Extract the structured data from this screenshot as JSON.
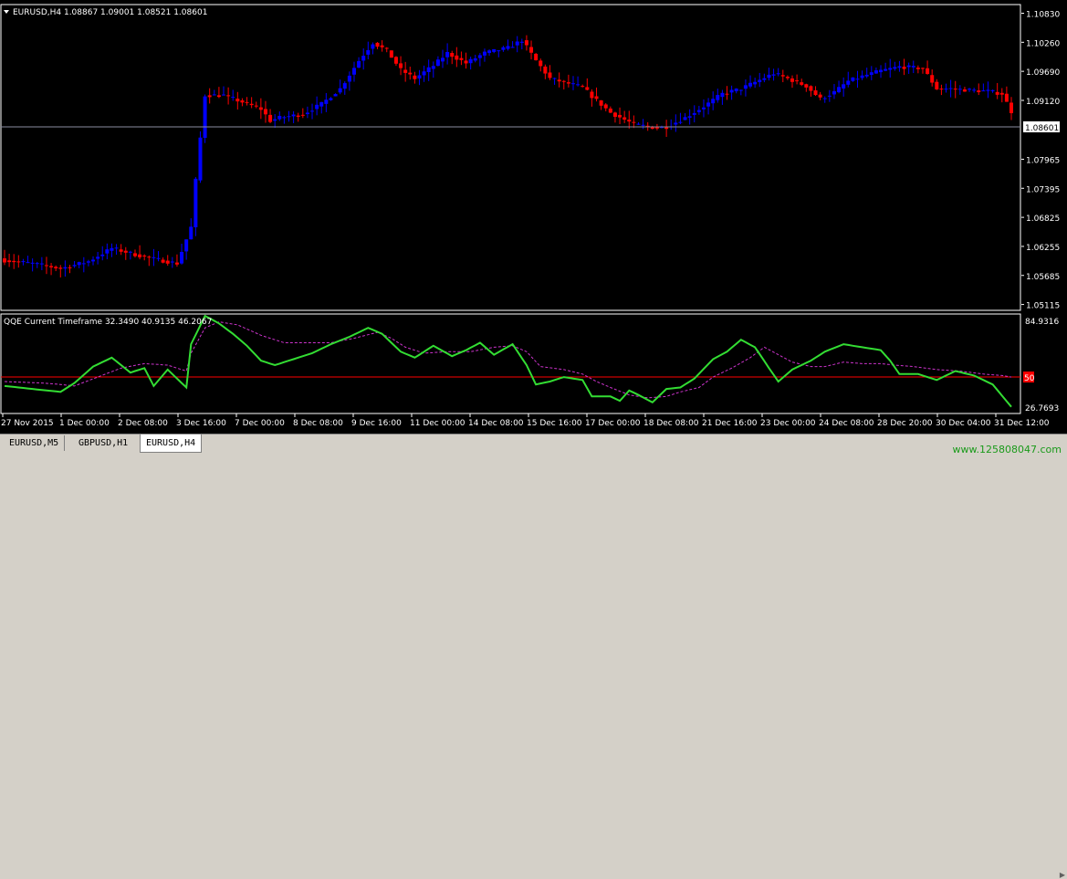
{
  "main_header": {
    "symbol": "EURUSD,H4",
    "ohlc": "1.08867 1.09001 1.08521 1.08601"
  },
  "indicator_header": {
    "label": "QQE Current Timeframe 32.3490 40.9135 46.2067"
  },
  "price_axis": {
    "labels": [
      "1.10830",
      "1.10260",
      "1.09690",
      "1.09120",
      "1.07965",
      "1.07395",
      "1.06825",
      "1.06255",
      "1.05685",
      "1.05115"
    ],
    "current": "1.08601"
  },
  "indicator_axis": {
    "top": "84.9316",
    "bottom": "26.7693",
    "level": "50"
  },
  "time_axis": {
    "labels": [
      "27 Nov 2015",
      "1 Dec 00:00",
      "2 Dec 08:00",
      "3 Dec 16:00",
      "7 Dec 00:00",
      "8 Dec 08:00",
      "9 Dec 16:00",
      "11 Dec 00:00",
      "14 Dec 08:00",
      "15 Dec 16:00",
      "17 Dec 00:00",
      "18 Dec 08:00",
      "21 Dec 16:00",
      "23 Dec 00:00",
      "24 Dec 08:00",
      "28 Dec 20:00",
      "30 Dec 04:00",
      "31 Dec 12:00"
    ]
  },
  "tabs": [
    "EURUSD,M5",
    "GBPUSD,H1",
    "EURUSD,H4"
  ],
  "active_tab": 2,
  "watermark": "www.125808047.com",
  "colors": {
    "background": "#000000",
    "bull": "#0000ff",
    "bear": "#ff0000",
    "qqe_line": "#33dd33",
    "qqe_signal": "#cc33cc",
    "level_line": "#ff0000",
    "current_price_line": "#8a8ca0",
    "axis_text": "#ffffff"
  },
  "chart_data": [
    {
      "type": "candlestick",
      "ylim": [
        1.05,
        1.11
      ],
      "anchors": [
        [
          0,
          1.0598
        ],
        [
          6,
          1.0592
        ],
        [
          12,
          1.0582
        ],
        [
          18,
          1.0596
        ],
        [
          23,
          1.0622
        ],
        [
          27,
          1.0612
        ],
        [
          31,
          1.0603
        ],
        [
          37,
          1.0592
        ],
        [
          40,
          1.0663
        ],
        [
          41,
          1.0755
        ],
        [
          43,
          1.0922
        ],
        [
          47,
          1.0922
        ],
        [
          50,
          1.0912
        ],
        [
          55,
          1.0895
        ],
        [
          57,
          1.0872
        ],
        [
          59,
          1.0878
        ],
        [
          64,
          1.0885
        ],
        [
          68,
          1.0905
        ],
        [
          72,
          1.0935
        ],
        [
          76,
          1.099
        ],
        [
          79,
          1.1025
        ],
        [
          82,
          1.101
        ],
        [
          85,
          1.0972
        ],
        [
          88,
          1.0955
        ],
        [
          92,
          1.098
        ],
        [
          95,
          1.1005
        ],
        [
          99,
          1.0985
        ],
        [
          103,
          1.1005
        ],
        [
          108,
          1.1015
        ],
        [
          111,
          1.103
        ],
        [
          114,
          1.099
        ],
        [
          117,
          1.0955
        ],
        [
          121,
          1.0945
        ],
        [
          124,
          1.0938
        ],
        [
          126,
          1.092
        ],
        [
          130,
          1.0888
        ],
        [
          135,
          1.0865
        ],
        [
          140,
          1.0858
        ],
        [
          142,
          1.086
        ],
        [
          146,
          1.0878
        ],
        [
          150,
          1.09
        ],
        [
          154,
          1.0925
        ],
        [
          158,
          1.0935
        ],
        [
          162,
          1.0952
        ],
        [
          165,
          1.0965
        ],
        [
          168,
          1.0955
        ],
        [
          172,
          1.094
        ],
        [
          175,
          1.0915
        ],
        [
          178,
          1.0928
        ],
        [
          181,
          1.095
        ],
        [
          185,
          1.0962
        ],
        [
          188,
          1.097
        ],
        [
          192,
          1.0978
        ],
        [
          197,
          1.0975
        ],
        [
          200,
          1.0935
        ],
        [
          203,
          1.0935
        ],
        [
          207,
          1.0932
        ],
        [
          211,
          1.093
        ],
        [
          214,
          1.0925
        ],
        [
          216,
          1.089
        ]
      ]
    },
    {
      "type": "line",
      "name": "QQE Current Timeframe",
      "ylim": [
        26.7693,
        84.9316
      ],
      "level": 50,
      "series": [
        {
          "values_anchor": [
            [
              0,
              44
            ],
            [
              6,
              42
            ],
            [
              12,
              40
            ],
            [
              15,
              46
            ],
            [
              19,
              57
            ],
            [
              23,
              63
            ],
            [
              27,
              53
            ],
            [
              30,
              56
            ],
            [
              32,
              44
            ],
            [
              35,
              55
            ],
            [
              39,
              43
            ],
            [
              40,
              72
            ],
            [
              43,
              91
            ],
            [
              46,
              86
            ],
            [
              49,
              79
            ],
            [
              52,
              71
            ],
            [
              55,
              61
            ],
            [
              58,
              58
            ],
            [
              62,
              62
            ],
            [
              66,
              66
            ],
            [
              70,
              72
            ],
            [
              74,
              77
            ],
            [
              78,
              83
            ],
            [
              81,
              79
            ],
            [
              85,
              67
            ],
            [
              88,
              63
            ],
            [
              92,
              71
            ],
            [
              96,
              64
            ],
            [
              99,
              68
            ],
            [
              102,
              73
            ],
            [
              105,
              65
            ],
            [
              109,
              72
            ],
            [
              112,
              58
            ],
            [
              114,
              45
            ],
            [
              117,
              47
            ],
            [
              120,
              50
            ],
            [
              124,
              48
            ],
            [
              126,
              37
            ],
            [
              130,
              37
            ],
            [
              132,
              34
            ],
            [
              134,
              41
            ],
            [
              136,
              38
            ],
            [
              139,
              33
            ],
            [
              142,
              42
            ],
            [
              145,
              43
            ],
            [
              148,
              49
            ],
            [
              152,
              62
            ],
            [
              155,
              67
            ],
            [
              158,
              75
            ],
            [
              161,
              70
            ],
            [
              164,
              56
            ],
            [
              166,
              47
            ],
            [
              169,
              55
            ],
            [
              173,
              61
            ],
            [
              176,
              67
            ],
            [
              180,
              72
            ],
            [
              184,
              70
            ],
            [
              188,
              68
            ],
            [
              190,
              61
            ],
            [
              192,
              52
            ],
            [
              196,
              52
            ],
            [
              200,
              48
            ],
            [
              204,
              54
            ],
            [
              208,
              51
            ],
            [
              212,
              45
            ],
            [
              216,
              30
            ]
          ]
        },
        {
          "values_anchor": [
            [
              0,
              47
            ],
            [
              8,
              46
            ],
            [
              12,
              45
            ],
            [
              15,
              44
            ],
            [
              20,
              50
            ],
            [
              25,
              56
            ],
            [
              30,
              59
            ],
            [
              35,
              58
            ],
            [
              39,
              54
            ],
            [
              40,
              66
            ],
            [
              43,
              83
            ],
            [
              46,
              87
            ],
            [
              50,
              85
            ],
            [
              55,
              78
            ],
            [
              60,
              73
            ],
            [
              65,
              73
            ],
            [
              70,
              73
            ],
            [
              75,
              76
            ],
            [
              80,
              80
            ],
            [
              83,
              76
            ],
            [
              86,
              70
            ],
            [
              90,
              66
            ],
            [
              95,
              67
            ],
            [
              100,
              67
            ],
            [
              105,
              70
            ],
            [
              109,
              71
            ],
            [
              112,
              67
            ],
            [
              115,
              57
            ],
            [
              120,
              55
            ],
            [
              124,
              52
            ],
            [
              127,
              47
            ],
            [
              130,
              43
            ],
            [
              134,
              38
            ],
            [
              138,
              36
            ],
            [
              142,
              37
            ],
            [
              145,
              40
            ],
            [
              149,
              43
            ],
            [
              152,
              50
            ],
            [
              156,
              56
            ],
            [
              160,
              63
            ],
            [
              163,
              70
            ],
            [
              166,
              65
            ],
            [
              169,
              60
            ],
            [
              173,
              57
            ],
            [
              176,
              57
            ],
            [
              180,
              60
            ],
            [
              184,
              59
            ],
            [
              188,
              59
            ],
            [
              191,
              58
            ],
            [
              195,
              57
            ],
            [
              200,
              55
            ],
            [
              205,
              54
            ],
            [
              210,
              52
            ],
            [
              214,
              51
            ],
            [
              216,
              50
            ]
          ]
        }
      ]
    }
  ]
}
